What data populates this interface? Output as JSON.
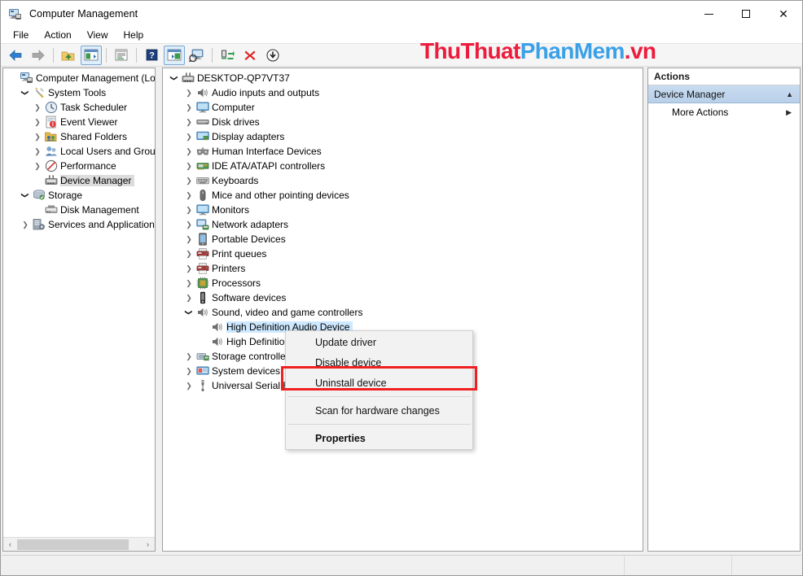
{
  "window": {
    "title": "Computer Management",
    "icon": "computer-management-icon",
    "controls": {
      "minimize": "—",
      "maximize": "□",
      "close": "✕"
    }
  },
  "menubar": {
    "items": [
      {
        "label": "File",
        "name": "menu-file"
      },
      {
        "label": "Action",
        "name": "menu-action"
      },
      {
        "label": "View",
        "name": "menu-view"
      },
      {
        "label": "Help",
        "name": "menu-help"
      }
    ]
  },
  "toolbar": {
    "buttons": [
      {
        "name": "back-icon",
        "active": false
      },
      {
        "name": "forward-icon",
        "active": false
      },
      {
        "name": "up-folder-icon",
        "active": false
      },
      {
        "name": "show-hide-console-tree-icon",
        "active": true
      },
      {
        "name": "properties-icon",
        "active": false
      },
      {
        "name": "help-icon",
        "active": false
      },
      {
        "name": "show-hide-action-pane-icon",
        "active": true
      },
      {
        "name": "scan-hardware-changes-icon",
        "active": false
      },
      {
        "name": "update-driver-icon",
        "active": false
      },
      {
        "name": "uninstall-device-icon",
        "active": false
      },
      {
        "name": "disable-device-icon",
        "active": false
      }
    ]
  },
  "watermark": {
    "part1": "ThuThuat",
    "part2": "PhanMem",
    "part3": ".vn",
    "color1": "#ec1c3c",
    "color2": "#3aa0e8"
  },
  "console_tree": {
    "nodes": [
      {
        "label": "Computer Management (Local",
        "indent": 0,
        "chev": "none",
        "icon": "computer-management-icon",
        "selected": false
      },
      {
        "label": "System Tools",
        "indent": 1,
        "chev": "open",
        "icon": "system-tools-icon",
        "selected": false
      },
      {
        "label": "Task Scheduler",
        "indent": 2,
        "chev": "closed",
        "icon": "task-scheduler-icon",
        "selected": false
      },
      {
        "label": "Event Viewer",
        "indent": 2,
        "chev": "closed",
        "icon": "event-viewer-icon",
        "selected": false
      },
      {
        "label": "Shared Folders",
        "indent": 2,
        "chev": "closed",
        "icon": "shared-folders-icon",
        "selected": false
      },
      {
        "label": "Local Users and Groups",
        "indent": 2,
        "chev": "closed",
        "icon": "local-users-icon",
        "selected": false
      },
      {
        "label": "Performance",
        "indent": 2,
        "chev": "closed",
        "icon": "performance-icon",
        "selected": false
      },
      {
        "label": "Device Manager",
        "indent": 2,
        "chev": "none",
        "icon": "device-manager-icon",
        "selected": true
      },
      {
        "label": "Storage",
        "indent": 1,
        "chev": "open",
        "icon": "storage-icon",
        "selected": false
      },
      {
        "label": "Disk Management",
        "indent": 2,
        "chev": "none",
        "icon": "disk-management-icon",
        "selected": false
      },
      {
        "label": "Services and Applications",
        "indent": 1,
        "chev": "closed",
        "icon": "services-apps-icon",
        "selected": false
      }
    ]
  },
  "device_tree": {
    "nodes": [
      {
        "label": "DESKTOP-QP7VT37",
        "indent": 0,
        "chev": "open",
        "icon": "computer-node-icon",
        "selected": false
      },
      {
        "label": "Audio inputs and outputs",
        "indent": 1,
        "chev": "closed",
        "icon": "speaker-icon",
        "selected": false
      },
      {
        "label": "Computer",
        "indent": 1,
        "chev": "closed",
        "icon": "monitor-icon",
        "selected": false
      },
      {
        "label": "Disk drives",
        "indent": 1,
        "chev": "closed",
        "icon": "disk-drive-icon",
        "selected": false
      },
      {
        "label": "Display adapters",
        "indent": 1,
        "chev": "closed",
        "icon": "display-adapter-icon",
        "selected": false
      },
      {
        "label": "Human Interface Devices",
        "indent": 1,
        "chev": "closed",
        "icon": "hid-icon",
        "selected": false
      },
      {
        "label": "IDE ATA/ATAPI controllers",
        "indent": 1,
        "chev": "closed",
        "icon": "ide-controller-icon",
        "selected": false
      },
      {
        "label": "Keyboards",
        "indent": 1,
        "chev": "closed",
        "icon": "keyboard-icon",
        "selected": false
      },
      {
        "label": "Mice and other pointing devices",
        "indent": 1,
        "chev": "closed",
        "icon": "mouse-icon",
        "selected": false
      },
      {
        "label": "Monitors",
        "indent": 1,
        "chev": "closed",
        "icon": "monitor-icon",
        "selected": false
      },
      {
        "label": "Network adapters",
        "indent": 1,
        "chev": "closed",
        "icon": "network-adapter-icon",
        "selected": false
      },
      {
        "label": "Portable Devices",
        "indent": 1,
        "chev": "closed",
        "icon": "portable-device-icon",
        "selected": false
      },
      {
        "label": "Print queues",
        "indent": 1,
        "chev": "closed",
        "icon": "printer-icon",
        "selected": false
      },
      {
        "label": "Printers",
        "indent": 1,
        "chev": "closed",
        "icon": "printer-icon",
        "selected": false
      },
      {
        "label": "Processors",
        "indent": 1,
        "chev": "closed",
        "icon": "processor-icon",
        "selected": false
      },
      {
        "label": "Software devices",
        "indent": 1,
        "chev": "closed",
        "icon": "software-device-icon",
        "selected": false
      },
      {
        "label": "Sound, video and game controllers",
        "indent": 1,
        "chev": "open",
        "icon": "speaker-icon",
        "selected": false
      },
      {
        "label": "High Definition Audio Device",
        "indent": 2,
        "chev": "none",
        "icon": "speaker-icon",
        "selected": true
      },
      {
        "label": "High Definition Audio Device",
        "indent": 2,
        "chev": "none",
        "icon": "speaker-icon",
        "selected": false
      },
      {
        "label": "Storage controllers",
        "indent": 1,
        "chev": "closed",
        "icon": "storage-controller-icon",
        "selected": false
      },
      {
        "label": "System devices",
        "indent": 1,
        "chev": "closed",
        "icon": "system-device-icon",
        "selected": false
      },
      {
        "label": "Universal Serial Bus controllers",
        "indent": 1,
        "chev": "closed",
        "icon": "usb-icon",
        "selected": false
      }
    ]
  },
  "context_menu": {
    "items": [
      {
        "label": "Update driver",
        "bold": false,
        "separator_after": false,
        "highlighted": false
      },
      {
        "label": "Disable device",
        "bold": false,
        "separator_after": false,
        "highlighted": false
      },
      {
        "label": "Uninstall device",
        "bold": false,
        "separator_after": true,
        "highlighted": true
      },
      {
        "label": "Scan for hardware changes",
        "bold": false,
        "separator_after": true,
        "highlighted": false
      },
      {
        "label": "Properties",
        "bold": true,
        "separator_after": false,
        "highlighted": false
      }
    ],
    "highlight_color": "#f02020"
  },
  "actions_pane": {
    "header": "Actions",
    "section": "Device Manager",
    "section_collapse_icon": "chevron-up-icon",
    "items": [
      {
        "label": "More Actions",
        "submenu_icon": "chevron-right-icon"
      }
    ]
  },
  "scrollbar": {
    "left_arrow": "‹",
    "right_arrow": "›"
  },
  "statusbar": {
    "cell1": "",
    "cell2": "",
    "cell3": ""
  }
}
